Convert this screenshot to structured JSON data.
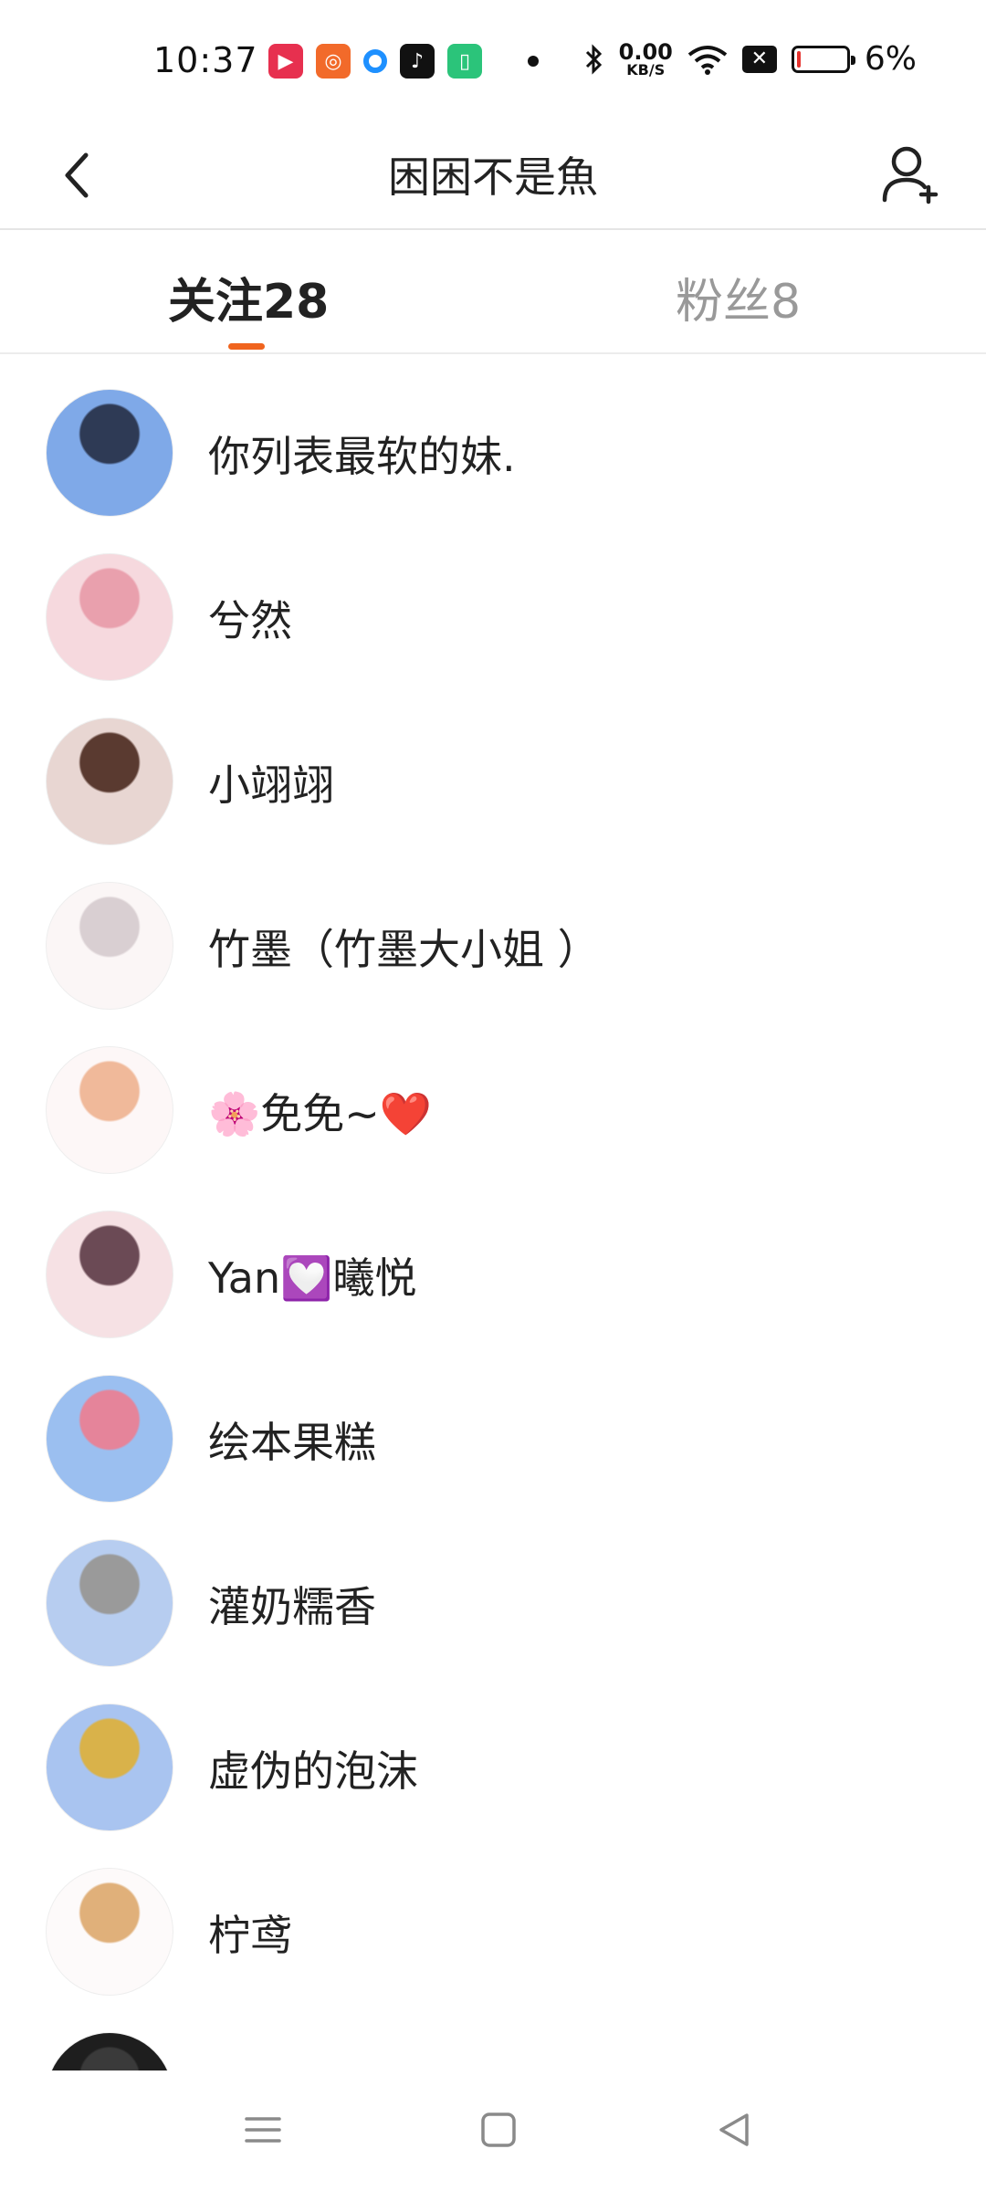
{
  "status_bar": {
    "time": "10:37",
    "net_speed_value": "0.00",
    "net_speed_unit": "KB/S",
    "battery_pct": "6%",
    "battery_level": 0.06
  },
  "header": {
    "title": "困困不是魚"
  },
  "tabs": [
    {
      "label": "关注28",
      "active": true
    },
    {
      "label": "粉丝8",
      "active": false
    }
  ],
  "users": [
    {
      "name": "你列表最软的妹.",
      "avatar_colors": [
        "#7fa9e8",
        "#2e3a55"
      ]
    },
    {
      "name": "兮然",
      "avatar_colors": [
        "#f6d9de",
        "#e9a0ad"
      ]
    },
    {
      "name": "小翊翊",
      "avatar_colors": [
        "#e8d6d2",
        "#5a3a30"
      ]
    },
    {
      "name": "竹墨（竹墨大小姐 ）",
      "avatar_colors": [
        "#fbf6f6",
        "#d9cfd2"
      ]
    },
    {
      "name": "🌸免免~❤️",
      "avatar_colors": [
        "#fdf7f7",
        "#f0b99a"
      ]
    },
    {
      "name": "Yan💟曦悦",
      "avatar_colors": [
        "#f6e1e4",
        "#6b4a55"
      ]
    },
    {
      "name": "绘本果糕",
      "avatar_colors": [
        "#9bbff0",
        "#e5849a"
      ]
    },
    {
      "name": "灌奶糯香",
      "avatar_colors": [
        "#b7cdf0",
        "#9a9a9a"
      ]
    },
    {
      "name": "虚伪的泡沫",
      "avatar_colors": [
        "#a9c4f0",
        "#d9b24a"
      ]
    },
    {
      "name": "柠鸢",
      "avatar_colors": [
        "#fdfafa",
        "#e0b07a"
      ]
    },
    {
      "name": "",
      "avatar_colors": [
        "#1e1e1e",
        "#3a3a3a"
      ]
    }
  ]
}
